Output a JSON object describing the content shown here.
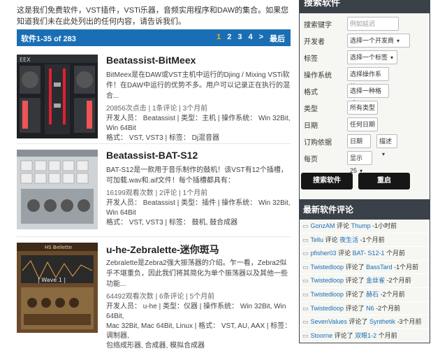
{
  "intro": "这是我们免费软件，VST插件，VSTi乐器，音频实用程序和DAW的集合。如果您知道我们未在此处列出的任何内容，请告诉我们。",
  "pagination": {
    "count_label": "软件1-35 of 283",
    "pages": [
      "1",
      "2",
      "3",
      "4"
    ],
    "current_page": "1",
    "next": ">",
    "last": "最后"
  },
  "items": [
    {
      "title": "Beatassist-BitMeex",
      "desc": "BitMeex是在DAW或VST主机中运行的Djing / Mixing VSTi软件！在DAW中运行的优势不多。用户可以记录正在执行的混合...",
      "stats_line": "20856次点击 | 1条评论 | 3个月前",
      "meta1": "开发人员： Beatassist | 类型：主机 | 操作系统： Win 32Bit, Win 64Bit",
      "meta2": "格式： VST, VST3 | 标签： Dj混音器"
    },
    {
      "title": "Beatassist-BAT-S12",
      "desc": "BAT-S12是一款用于音乐制作的鼓机！该VST有12个插槽，可加载.wav和.aif文件！每个插槽都具有：",
      "stats_line": "16199观看次数 | 2评论 | 1个月前",
      "meta1": "开发人员： Beatassist | 类型：插件 | 操作系统： Win 32Bit, Win 64Bit",
      "meta2": "格式： VST, VST3 | 标签： 鼓机, 鼓合成器"
    },
    {
      "title": "u-he-Zebralette-迷你斑马",
      "desc": "Zebralette是Zebra2强大振荡器的介绍。乍一看，Zebra2似乎不堪重负，因此我们将其简化为单个振荡器以及其他一些功能...",
      "stats_line": "64492观看次数 | 6条评论 | 5个月前",
      "meta1": "开发人员： u-he | 类型：仪器 | 操作系统： Win 32Bit, Win 64Bit,",
      "meta2": "Mac 32Bit, Mac 64Bit, Linux | 格式： VST, AU, AAX | 标签： 调制器,",
      "meta3": "包络成形器, 合成器, 模拟合成器"
    }
  ],
  "search": {
    "header": "搜索软件",
    "fields": [
      {
        "label": "搜索键字",
        "value": "例如延迟"
      },
      {
        "label": "开发者",
        "value": "选择一个开发商"
      },
      {
        "label": "标签",
        "value": "选择一个标签"
      },
      {
        "label": "操作系统",
        "value": "选择操作系统"
      },
      {
        "label": "格式",
        "value": "选择一种格式"
      },
      {
        "label": "类型",
        "value": "所有类型"
      },
      {
        "label": "日期",
        "value": "任何日期"
      },
      {
        "label": "订购依据",
        "value": "日期",
        "value2": "描述"
      },
      {
        "label": "每页",
        "value": "显示25"
      }
    ],
    "search_button": "搜索软件",
    "reset_button": "重启"
  },
  "comments": {
    "header": "最新软件评论",
    "rows": [
      {
        "user": "GonzAM",
        "verb": "评论",
        "target": "Thump",
        "time": "-1小时前"
      },
      {
        "user": "Tellu",
        "verb": "评论",
        "target": "夜生活",
        "time": "-1个月前"
      },
      {
        "user": "pfisher03",
        "verb": "评论",
        "target": "BAT- S12-1",
        "time": "个月前"
      },
      {
        "user": "Twistedloop",
        "verb": "评论了",
        "target": "BassTard",
        "time": "-1个月前"
      },
      {
        "user": "Twistedloop",
        "verb": "评论了",
        "target": "金丝雀",
        "time": "-2个月前"
      },
      {
        "user": "Twistedloop",
        "verb": "评论了",
        "target": "赫石",
        "time": "-2个月前"
      },
      {
        "user": "Twistedloop",
        "verb": "评论了",
        "target": "N6",
        "time": "-2个月前"
      },
      {
        "user": "SevenValues",
        "verb": "评论了",
        "target": "Synthetik",
        "time": "-3个月前"
      },
      {
        "user": "Stoorne",
        "verb": "评论了",
        "target": "双眼1-2",
        "time": "个月前"
      }
    ]
  },
  "colors": {
    "accent": "#1a6fb4",
    "sidebar_dark": "#3a4149",
    "button": "#161616",
    "page_current": "#f5a623"
  }
}
